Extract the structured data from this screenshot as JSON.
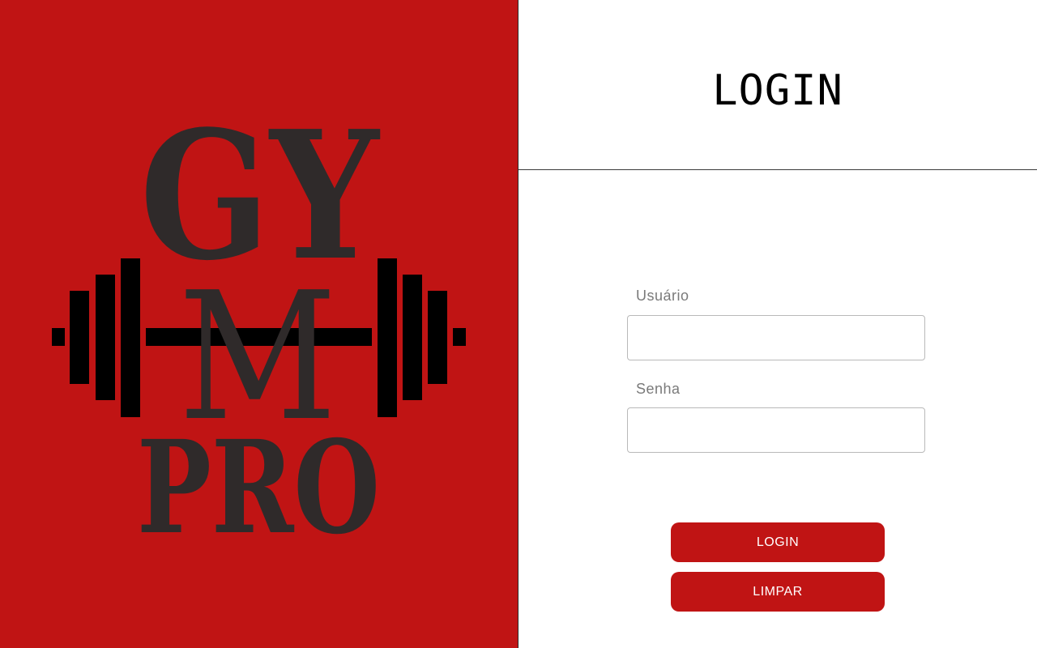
{
  "brand": {
    "logo_line1": "GY",
    "logo_line2": "M",
    "logo_line3": "PRO"
  },
  "header": {
    "title": "LOGIN"
  },
  "form": {
    "username_label": "Usuário",
    "username_value": "",
    "password_label": "Senha",
    "password_value": ""
  },
  "actions": {
    "login_label": "LOGIN",
    "clear_label": "LIMPAR"
  },
  "colors": {
    "brand_red": "#c01414",
    "logo_text": "#2f2a2a",
    "barbell": "#000000"
  },
  "icons": {
    "barbell": "barbell-icon"
  }
}
